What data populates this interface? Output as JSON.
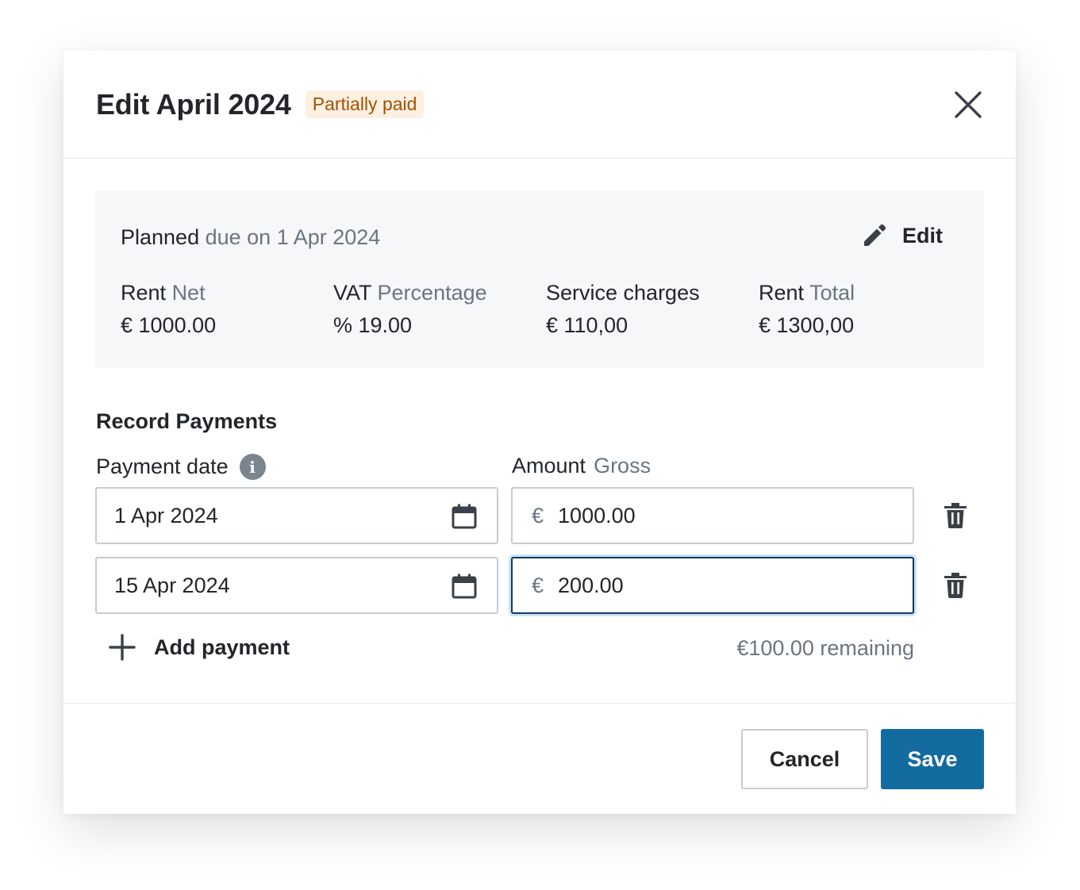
{
  "dialog": {
    "title": "Edit April 2024",
    "status_badge": "Partially paid"
  },
  "summary": {
    "planned_label": "Planned",
    "due_text": "due on 1 Apr 2024",
    "edit_label": "Edit",
    "columns": [
      {
        "label": "Rent",
        "label_muted": "Net",
        "value": "€ 1000.00"
      },
      {
        "label": "VAT",
        "label_muted": "Percentage",
        "value": "% 19.00"
      },
      {
        "label": "Service charges",
        "label_muted": "",
        "value": "€ 110,00"
      },
      {
        "label": "Rent",
        "label_muted": "Total",
        "value": "€ 1300,00"
      }
    ]
  },
  "payments": {
    "section_title": "Record Payments",
    "date_label": "Payment date",
    "amount_label": "Amount",
    "amount_label_muted": "Gross",
    "currency_symbol": "€",
    "rows": [
      {
        "date": "1 Apr 2024",
        "amount": "1000.00"
      },
      {
        "date": "15 Apr 2024",
        "amount": "200.00"
      }
    ],
    "add_label": "Add payment",
    "remaining_text": "€100.00 remaining"
  },
  "footer": {
    "cancel_label": "Cancel",
    "save_label": "Save"
  },
  "colors": {
    "primary": "#136ba0",
    "badge_bg": "#fdf0e1",
    "badge_text": "#a35200",
    "focus_border": "#11395e"
  }
}
